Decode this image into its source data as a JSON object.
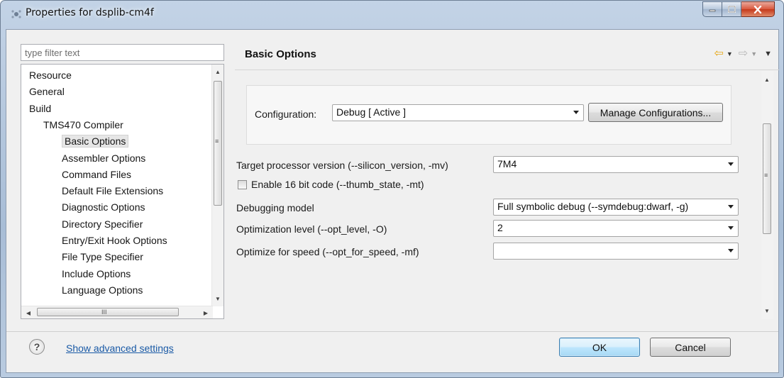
{
  "window": {
    "title": "Properties for dsplib-cm4f"
  },
  "left": {
    "filter_placeholder": "type filter text",
    "tree": [
      {
        "label": "Resource",
        "level": 0
      },
      {
        "label": "General",
        "level": 0
      },
      {
        "label": "Build",
        "level": 0
      },
      {
        "label": "TMS470 Compiler",
        "level": 1
      },
      {
        "label": "Basic Options",
        "level": 2,
        "selected": true
      },
      {
        "label": "Assembler Options",
        "level": 2
      },
      {
        "label": "Command Files",
        "level": 2
      },
      {
        "label": "Default File Extensions",
        "level": 2
      },
      {
        "label": "Diagnostic Options",
        "level": 2
      },
      {
        "label": "Directory Specifier",
        "level": 2
      },
      {
        "label": "Entry/Exit Hook Options",
        "level": 2
      },
      {
        "label": "File Type Specifier",
        "level": 2
      },
      {
        "label": "Include Options",
        "level": 2
      },
      {
        "label": "Language Options",
        "level": 2
      }
    ],
    "scroll_grip": "≡",
    "hscroll_grip": "III"
  },
  "right": {
    "page_title": "Basic Options",
    "config_label": "Configuration:",
    "config_value": "Debug  [ Active ]",
    "manage_button": "Manage Configurations...",
    "options": [
      {
        "label": "Target processor version (--silicon_version, -mv)",
        "value": "7M4"
      },
      {
        "label": "Debugging model",
        "value": "Full symbolic debug (--symdebug:dwarf, -g)"
      },
      {
        "label": "Optimization level (--opt_level, -O)",
        "value": "2"
      },
      {
        "label": "Optimize for speed (--opt_for_speed, -mf)",
        "value": ""
      }
    ],
    "checkbox_label": "Enable 16 bit code (--thumb_state, -mt)",
    "checkbox_checked": false
  },
  "footer": {
    "help_glyph": "?",
    "advanced_link": "Show advanced settings",
    "ok_button": "OK",
    "cancel_button": "Cancel"
  },
  "icons": {
    "back": "⇦",
    "forward": "⇨",
    "dropdown": "▼",
    "scroll_up": "▲",
    "scroll_down": "▼",
    "scroll_left": "◀",
    "scroll_right": "▶"
  },
  "colors": {
    "link": "#1a5aa6",
    "back_arrow": "#e6a817",
    "forward_arrow": "#b8b8b8",
    "close_button": "#c5391c"
  }
}
